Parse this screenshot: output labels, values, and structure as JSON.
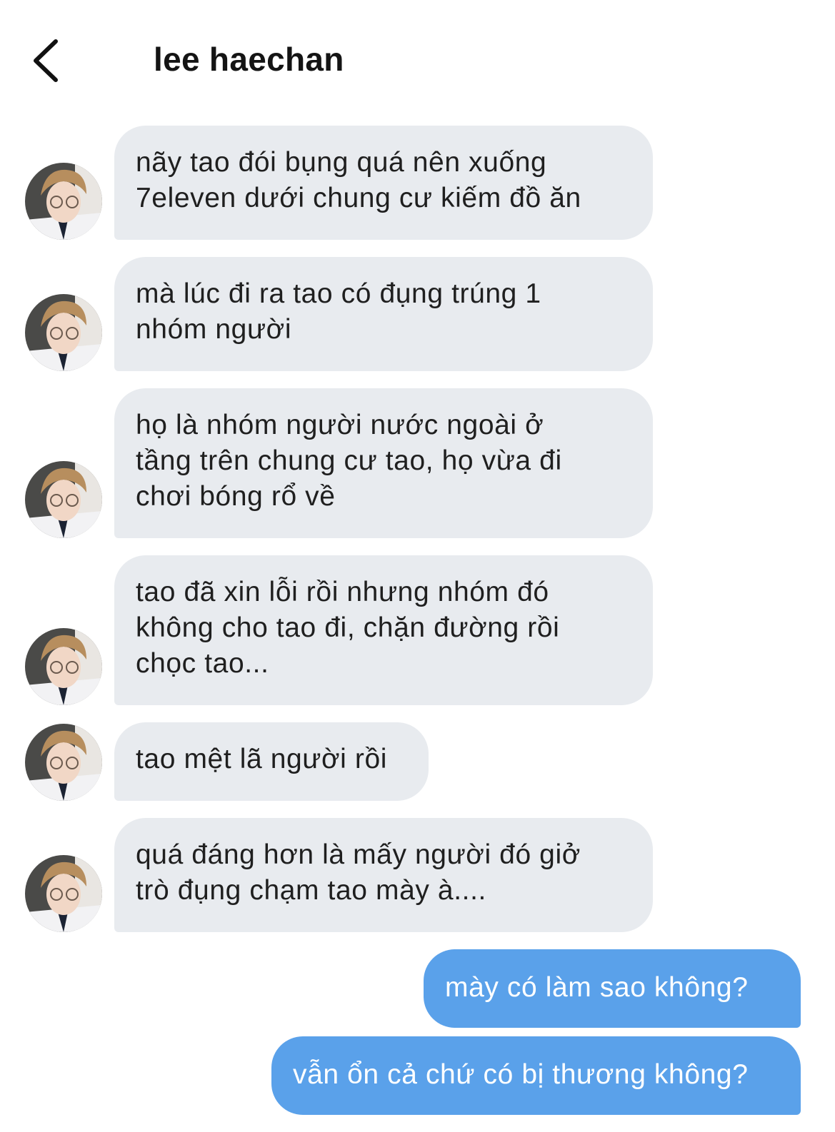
{
  "header": {
    "title": "lee haechan",
    "back_icon": "chevron-left-icon"
  },
  "contact": {
    "avatar_icon": "contact-avatar"
  },
  "colors": {
    "incoming_bubble": "#e8ebef",
    "outgoing_bubble": "#5aa1ea",
    "incoming_text": "#1f1f1f",
    "outgoing_text": "#ffffff"
  },
  "messages": [
    {
      "direction": "incoming",
      "lines": [
        "nãy tao đói bụng quá nên xuống",
        "7eleven dưới chung cư kiếm đồ ăn"
      ]
    },
    {
      "direction": "incoming",
      "lines": [
        "mà lúc đi ra tao có đụng trúng 1",
        "nhóm người"
      ]
    },
    {
      "direction": "incoming",
      "lines": [
        "họ là nhóm người nước ngoài ở",
        "tầng trên chung cư tao, họ vừa đi",
        "chơi bóng rổ về"
      ]
    },
    {
      "direction": "incoming",
      "lines": [
        "tao đã xin lỗi rồi nhưng nhóm đó",
        "không cho tao đi, chặn đường rồi",
        "chọc tao..."
      ]
    },
    {
      "direction": "incoming",
      "lines": [
        "tao mệt lã người rồi"
      ]
    },
    {
      "direction": "incoming",
      "lines": [
        "quá đáng hơn là mấy người đó giở",
        "trò đụng chạm tao mày à...."
      ]
    },
    {
      "direction": "outgoing",
      "lines": [
        "mày có làm sao không?"
      ]
    },
    {
      "direction": "outgoing",
      "lines": [
        "vẫn ổn cả chứ có bị thương không?"
      ]
    }
  ]
}
